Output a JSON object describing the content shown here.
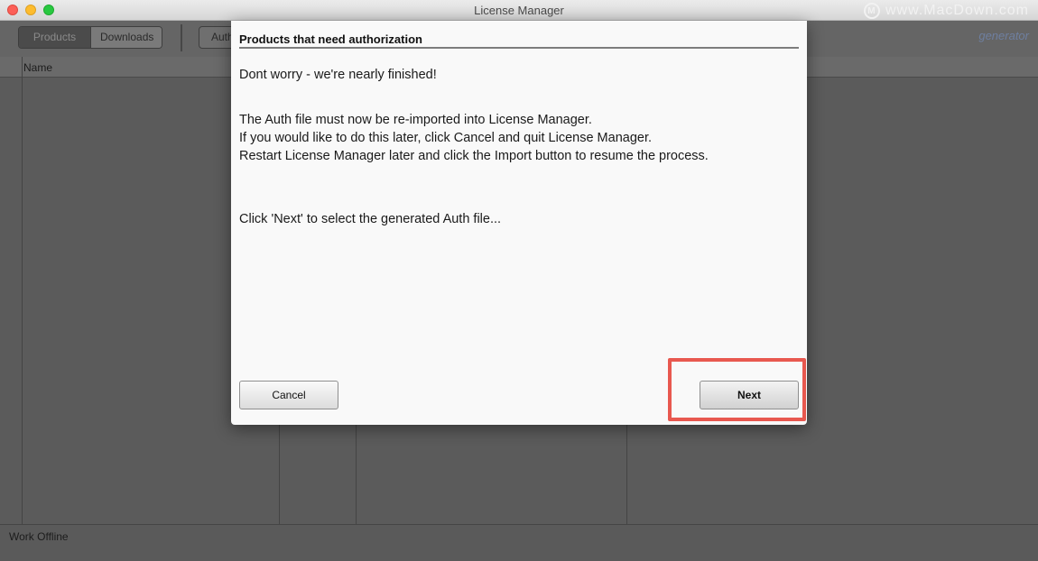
{
  "window": {
    "title": "License Manager"
  },
  "watermark": {
    "text": "www.MacDown.com"
  },
  "toolbar": {
    "tabs": [
      {
        "label": "Products",
        "active": true
      },
      {
        "label": "Downloads",
        "active": false
      }
    ],
    "auth_label": "Auth",
    "logo_text": "generator"
  },
  "table": {
    "column_name": "Name"
  },
  "status": {
    "text": "Work Offline"
  },
  "dialog": {
    "title": "Products that need authorization",
    "line1": "Dont worry - we're nearly finished!",
    "line2": "The Auth file must now be re-imported into License Manager.",
    "line3": "If you would like to do this later, click Cancel and quit License Manager.",
    "line4": "Restart License Manager later and click the Import button to resume the process.",
    "line5": "Click 'Next' to select the generated Auth file...",
    "cancel_label": "Cancel",
    "next_label": "Next"
  },
  "colors": {
    "highlight": "#e8584f"
  }
}
